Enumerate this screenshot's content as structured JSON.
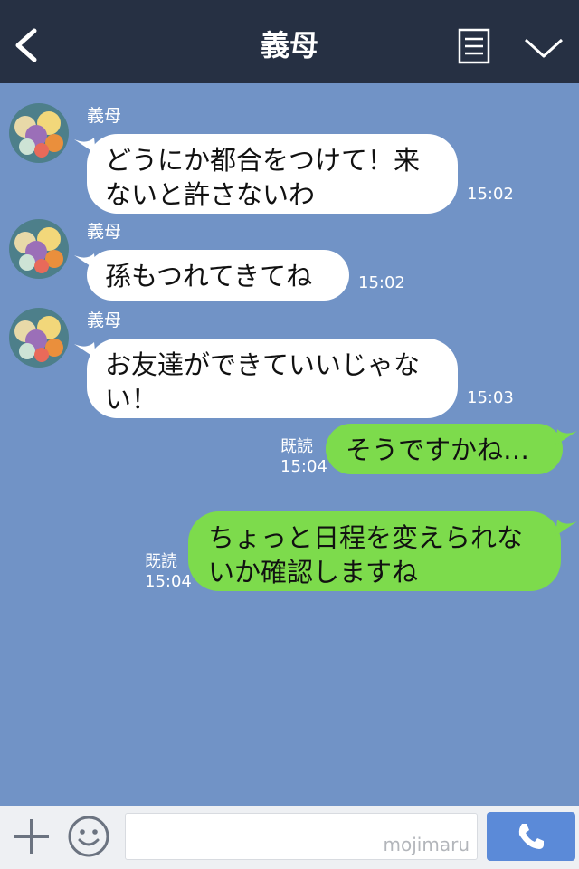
{
  "header": {
    "title": "義母"
  },
  "messages": [
    {
      "sender": "義母",
      "lines": [
        "どうにか都合をつけて！来",
        "ないと許さないわ"
      ],
      "time": "15:02"
    },
    {
      "sender": "義母",
      "lines": [
        "孫もつれてきてね"
      ],
      "time": "15:02"
    },
    {
      "sender": "義母",
      "lines": [
        "お友達ができていいじゃな",
        "い！"
      ],
      "time": "15:03"
    }
  ],
  "sent": [
    {
      "lines": [
        "そうですかね…"
      ],
      "read": "既読",
      "time": "15:04"
    },
    {
      "lines": [
        "ちょっと日程を変えられな",
        "いか確認しますね"
      ],
      "read": "既読",
      "time": "15:04"
    }
  ],
  "input": {
    "watermark": "mojimaru"
  },
  "colors": {
    "background": "#7193c6",
    "header": "#263043",
    "sent_bubble": "#7ddb4c",
    "call_button": "#5b8ad8"
  },
  "icons": [
    "back-icon",
    "menu-icon",
    "chevron-down-icon",
    "plus-icon",
    "emoji-icon",
    "phone-icon"
  ]
}
